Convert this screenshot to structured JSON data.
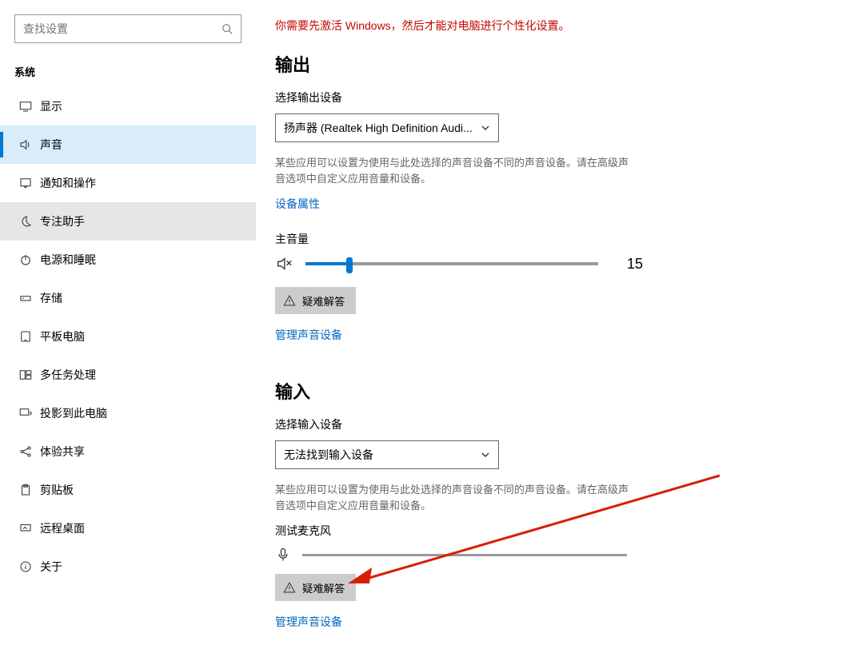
{
  "search": {
    "placeholder": "查找设置"
  },
  "sidebar": {
    "section": "系统",
    "items": [
      {
        "label": "显示"
      },
      {
        "label": "声音"
      },
      {
        "label": "通知和操作"
      },
      {
        "label": "专注助手"
      },
      {
        "label": "电源和睡眠"
      },
      {
        "label": "存储"
      },
      {
        "label": "平板电脑"
      },
      {
        "label": "多任务处理"
      },
      {
        "label": "投影到此电脑"
      },
      {
        "label": "体验共享"
      },
      {
        "label": "剪贴板"
      },
      {
        "label": "远程桌面"
      },
      {
        "label": "关于"
      }
    ]
  },
  "main": {
    "activation_warning": "你需要先激活 Windows，然后才能对电脑进行个性化设置。",
    "output": {
      "heading": "输出",
      "select_label": "选择输出设备",
      "select_value": "扬声器 (Realtek High Definition Audi...",
      "desc": "某些应用可以设置为使用与此处选择的声音设备不同的声音设备。请在高级声音选项中自定义应用音量和设备。",
      "props_link": "设备属性",
      "master_volume_label": "主音量",
      "volume_value": "15",
      "troubleshoot_label": "疑难解答",
      "manage_link": "管理声音设备"
    },
    "input": {
      "heading": "输入",
      "select_label": "选择输入设备",
      "select_value": "无法找到输入设备",
      "desc": "某些应用可以设置为使用与此处选择的声音设备不同的声音设备。请在高级声音选项中自定义应用音量和设备。",
      "test_mic_label": "测试麦克风",
      "troubleshoot_label": "疑难解答",
      "manage_link": "管理声音设备"
    }
  }
}
